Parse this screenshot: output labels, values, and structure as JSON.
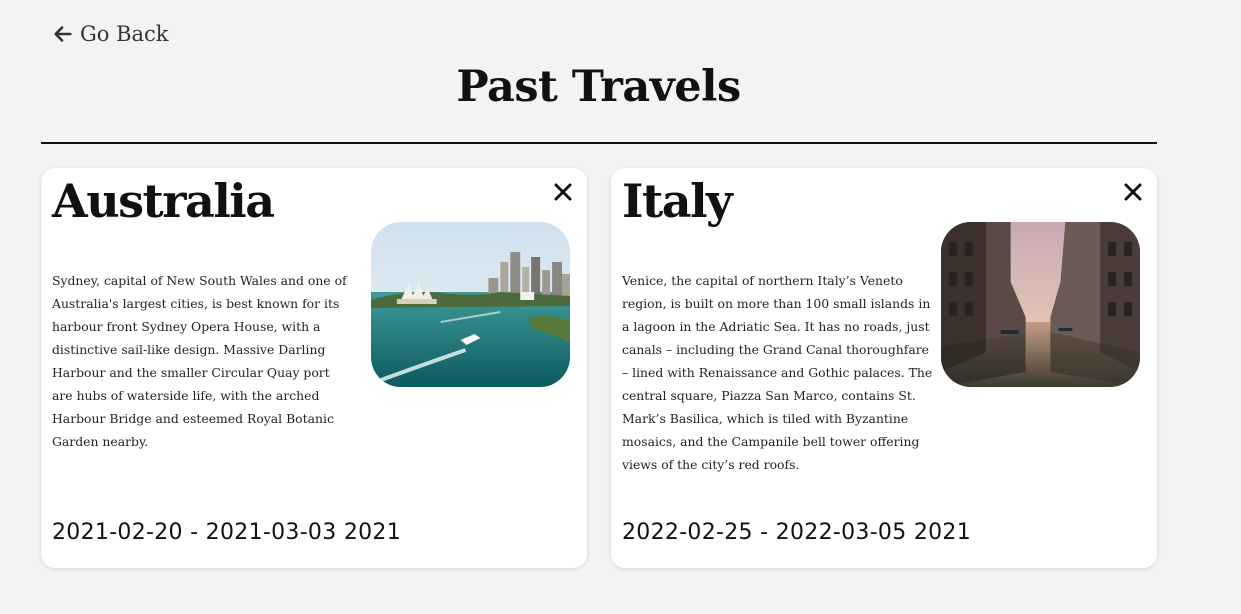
{
  "nav": {
    "back_label": "Go Back",
    "back_icon": "arrow-left-icon"
  },
  "page": {
    "title": "Past Travels"
  },
  "trips": [
    {
      "country": "Australia",
      "description": "Sydney, capital of New South Wales and one of Australia's largest cities, is best known for its harbour front Sydney Opera House, with a distinctive sail-like design. Massive Darling Harbour and the smaller Circular Quay port are hubs of waterside life, with the arched Harbour Bridge and esteemed Royal Botanic Garden nearby.",
      "dates": "2021-02-20 - 2021-03-03 2021",
      "close_icon": "close-icon"
    },
    {
      "country": "Italy",
      "description": "Venice, the capital of northern Italy’s Veneto region, is built on more than 100 small islands in a lagoon in the Adriatic Sea. It has no roads, just canals – including the Grand Canal thoroughfare – lined with Renaissance and Gothic palaces. The central square, Piazza San Marco, contains St. Mark’s Basilica, which is tiled with Byzantine mosaics, and the Campanile bell tower offering views of the city’s red roofs.",
      "dates": "2022-02-25 - 2022-03-05 2021",
      "close_icon": "close-icon"
    }
  ],
  "colors": {
    "background": "#f3f3f4",
    "card": "#ffffff",
    "text": "#111111"
  }
}
